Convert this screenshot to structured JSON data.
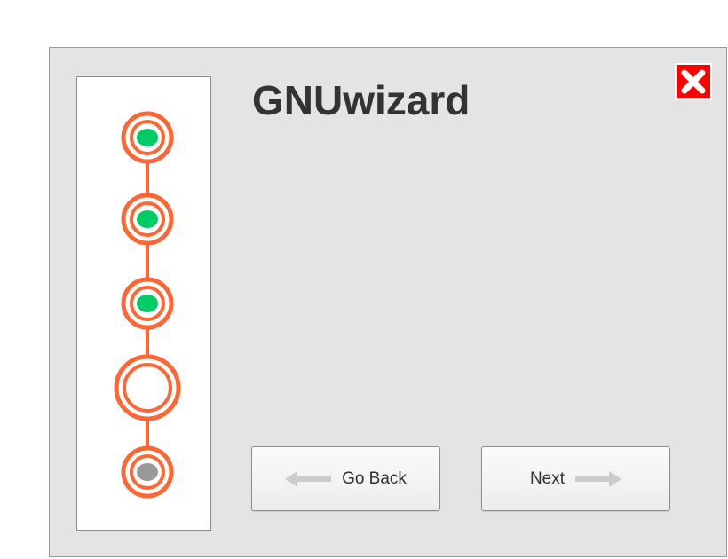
{
  "window": {
    "title": "GNUwizard"
  },
  "steps": [
    {
      "state": "complete"
    },
    {
      "state": "complete"
    },
    {
      "state": "complete"
    },
    {
      "state": "current"
    },
    {
      "state": "pending"
    }
  ],
  "buttons": {
    "back_label": "Go Back",
    "next_label": "Next",
    "close_icon": "close-icon"
  },
  "colors": {
    "step_ring": "#ff6633",
    "step_complete": "#00cc66",
    "step_pending": "#999999",
    "close_bg": "#ff0000",
    "arrow": "#cccccc",
    "window_bg": "#e4e4e4",
    "title_text": "#333333"
  }
}
